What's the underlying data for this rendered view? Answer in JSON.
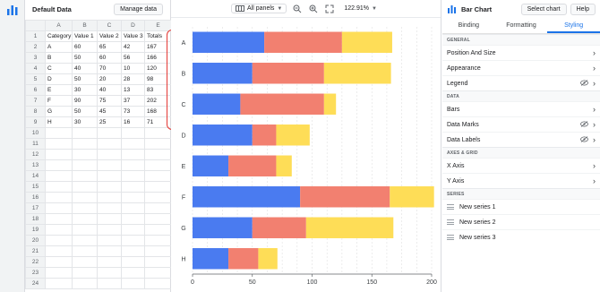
{
  "sheet": {
    "title": "Default Data",
    "manage_label": "Manage data",
    "col_letters": [
      "",
      "A",
      "B",
      "C",
      "D",
      "E"
    ],
    "rows": [
      [
        "1",
        "Category",
        "Value 1",
        "Value 2",
        "Value 3",
        "Totals"
      ],
      [
        "2",
        "A",
        "60",
        "65",
        "42",
        "167"
      ],
      [
        "3",
        "B",
        "50",
        "60",
        "56",
        "166"
      ],
      [
        "4",
        "C",
        "40",
        "70",
        "10",
        "120"
      ],
      [
        "5",
        "D",
        "50",
        "20",
        "28",
        "98"
      ],
      [
        "6",
        "E",
        "30",
        "40",
        "13",
        "83"
      ],
      [
        "7",
        "F",
        "90",
        "75",
        "37",
        "202"
      ],
      [
        "8",
        "G",
        "50",
        "45",
        "73",
        "168"
      ],
      [
        "9",
        "H",
        "30",
        "25",
        "16",
        "71"
      ],
      [
        "10",
        "",
        "",
        "",
        "",
        ""
      ],
      [
        "11",
        "",
        "",
        "",
        "",
        ""
      ],
      [
        "12",
        "",
        "",
        "",
        "",
        ""
      ],
      [
        "13",
        "",
        "",
        "",
        "",
        ""
      ],
      [
        "14",
        "",
        "",
        "",
        "",
        ""
      ],
      [
        "15",
        "",
        "",
        "",
        "",
        ""
      ],
      [
        "16",
        "",
        "",
        "",
        "",
        ""
      ],
      [
        "17",
        "",
        "",
        "",
        "",
        ""
      ],
      [
        "18",
        "",
        "",
        "",
        "",
        ""
      ],
      [
        "19",
        "",
        "",
        "",
        "",
        ""
      ],
      [
        "20",
        "",
        "",
        "",
        "",
        ""
      ],
      [
        "21",
        "",
        "",
        "",
        "",
        ""
      ],
      [
        "22",
        "",
        "",
        "",
        "",
        ""
      ],
      [
        "23",
        "",
        "",
        "",
        "",
        ""
      ],
      [
        "24",
        "",
        "",
        "",
        "",
        ""
      ]
    ]
  },
  "toolbar": {
    "panels_label": "All panels",
    "zoom_label": "122.91%"
  },
  "side": {
    "title": "Bar Chart",
    "select_label": "Select chart",
    "help_label": "Help",
    "tabs": [
      "Binding",
      "Formatting",
      "Styling"
    ],
    "active_tab": "Styling",
    "sections": [
      {
        "title": "GENERAL",
        "items": [
          {
            "label": "Position And Size",
            "eye": false
          },
          {
            "label": "Appearance",
            "eye": false
          },
          {
            "label": "Legend",
            "eye": true
          }
        ]
      },
      {
        "title": "DATA",
        "items": [
          {
            "label": "Bars",
            "eye": false
          },
          {
            "label": "Data Marks",
            "eye": true
          },
          {
            "label": "Data Labels",
            "eye": true
          }
        ]
      },
      {
        "title": "AXES & GRID",
        "items": [
          {
            "label": "X Axis",
            "eye": false
          },
          {
            "label": "Y Axis",
            "eye": false
          }
        ]
      },
      {
        "title": "SERIES",
        "items": [
          {
            "label": "New series 1",
            "eye": false,
            "drag": true
          },
          {
            "label": "New series 2",
            "eye": false,
            "drag": true
          },
          {
            "label": "New series 3",
            "eye": false,
            "drag": true
          }
        ]
      }
    ]
  },
  "colors": {
    "accent": "#1a73e8",
    "highlight": "#e53935",
    "series": [
      "#4a7bf0",
      "#f28070",
      "#fedd57"
    ]
  },
  "chart_data": {
    "type": "bar",
    "orientation": "horizontal",
    "stacked": true,
    "categories": [
      "A",
      "B",
      "C",
      "D",
      "E",
      "F",
      "G",
      "H"
    ],
    "series": [
      {
        "values": [
          60,
          50,
          40,
          50,
          30,
          90,
          50,
          30
        ]
      },
      {
        "values": [
          65,
          60,
          70,
          20,
          40,
          75,
          45,
          25
        ]
      },
      {
        "values": [
          42,
          56,
          10,
          28,
          13,
          37,
          73,
          16
        ]
      }
    ],
    "xlim": [
      0,
      200
    ],
    "xticks": [
      "0",
      "50",
      "100",
      "150",
      "200"
    ],
    "grid": true
  }
}
